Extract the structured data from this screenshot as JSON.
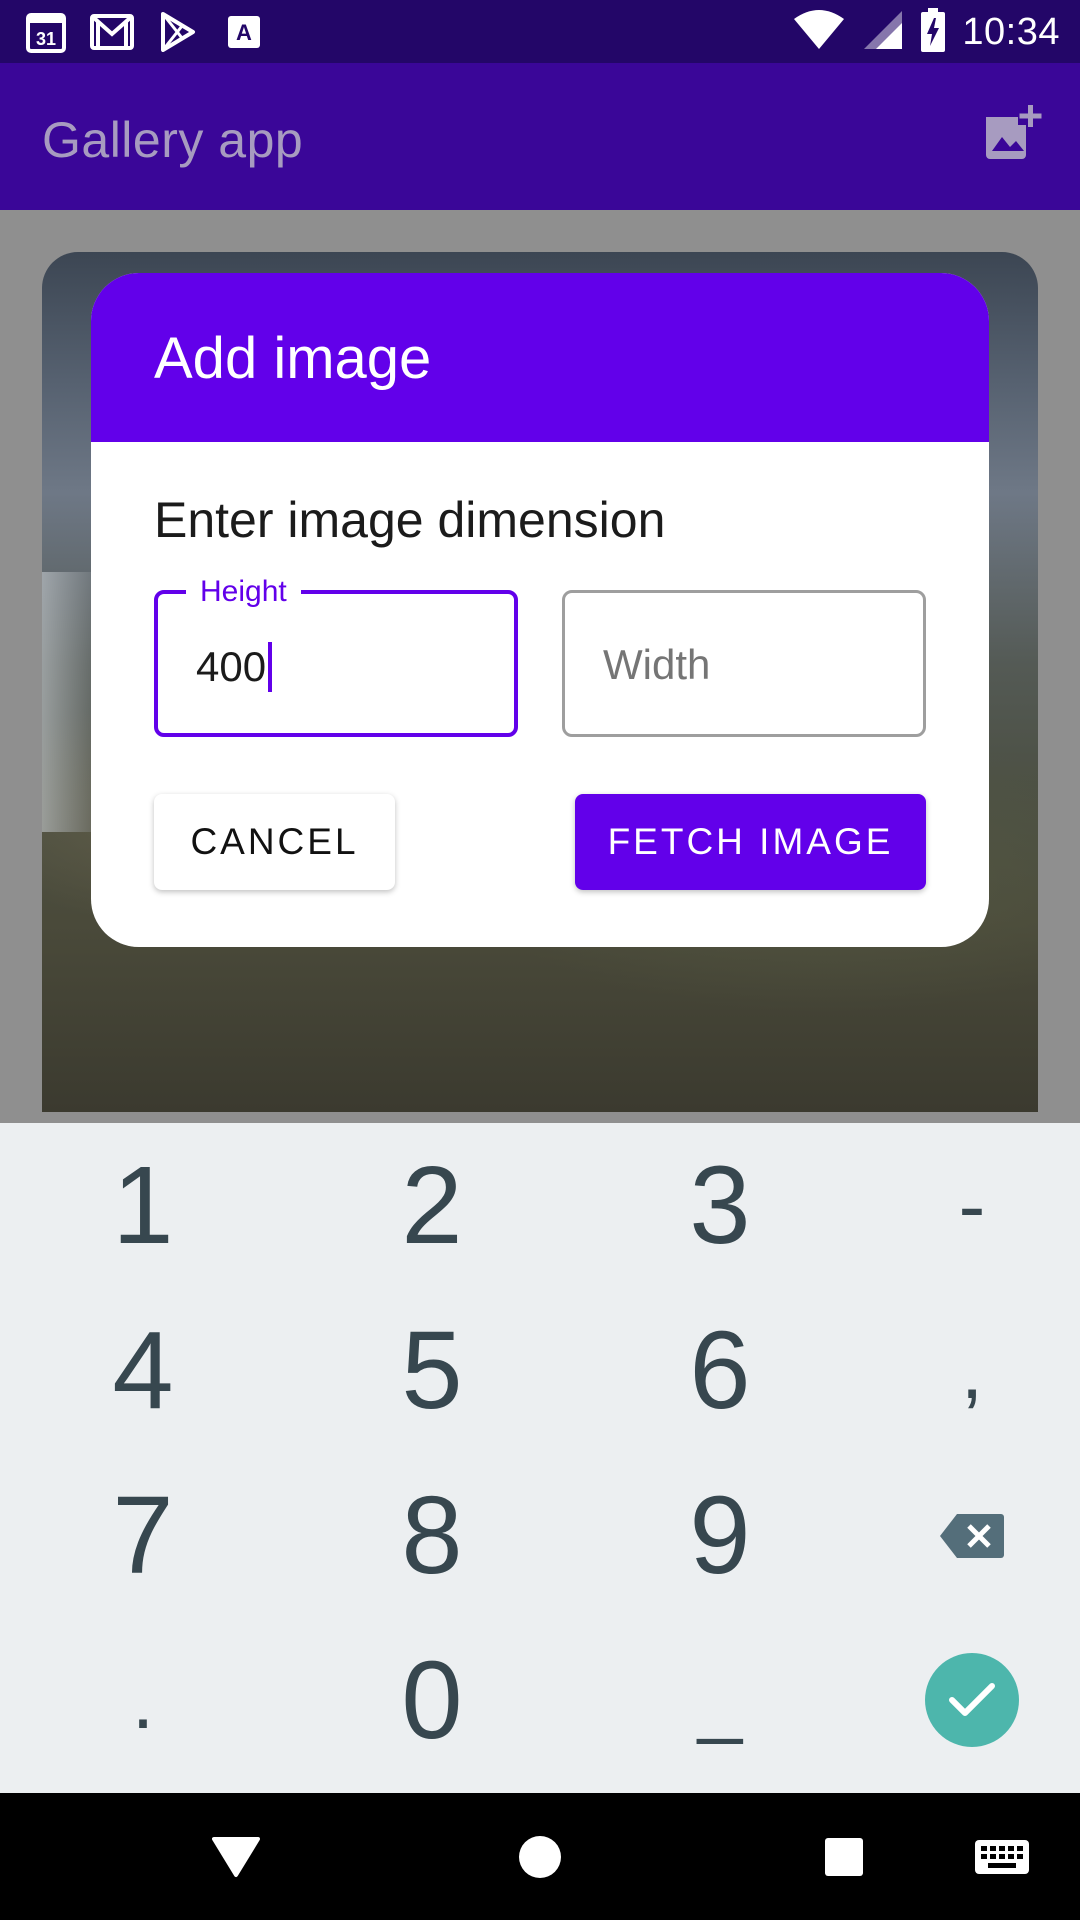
{
  "status_bar": {
    "time": "10:34",
    "calendar_day": "31",
    "left_icons": [
      "calendar-icon",
      "gmail-icon",
      "play-store-icon",
      "font-icon"
    ],
    "right_icons": [
      "wifi-icon",
      "signal-icon",
      "battery-charging-icon"
    ]
  },
  "app_bar": {
    "title": "Gallery app",
    "action_icon": "add-photo-icon"
  },
  "dialog": {
    "title": "Add image",
    "subtitle": "Enter image dimension",
    "height_field": {
      "label": "Height",
      "value": "400"
    },
    "width_field": {
      "placeholder": "Width",
      "value": ""
    },
    "cancel_label": "CANCEL",
    "fetch_label": "FETCH IMAGE"
  },
  "keyboard": {
    "keys": [
      [
        "1",
        "2",
        "3",
        "-"
      ],
      [
        "4",
        "5",
        "6",
        ","
      ],
      [
        "7",
        "8",
        "9",
        "backspace"
      ],
      [
        ".",
        "0",
        "_",
        "enter"
      ]
    ],
    "enter_icon": "check-icon",
    "backspace_icon": "backspace-icon"
  },
  "nav_bar": {
    "buttons": [
      "back-icon",
      "home-icon",
      "recents-icon",
      "keyboard-switch-icon"
    ]
  },
  "colors": {
    "primary": "#6200ea",
    "status_bar": "#230668",
    "keyboard_bg": "#eceff1",
    "enter_key": "#4db6ac"
  }
}
